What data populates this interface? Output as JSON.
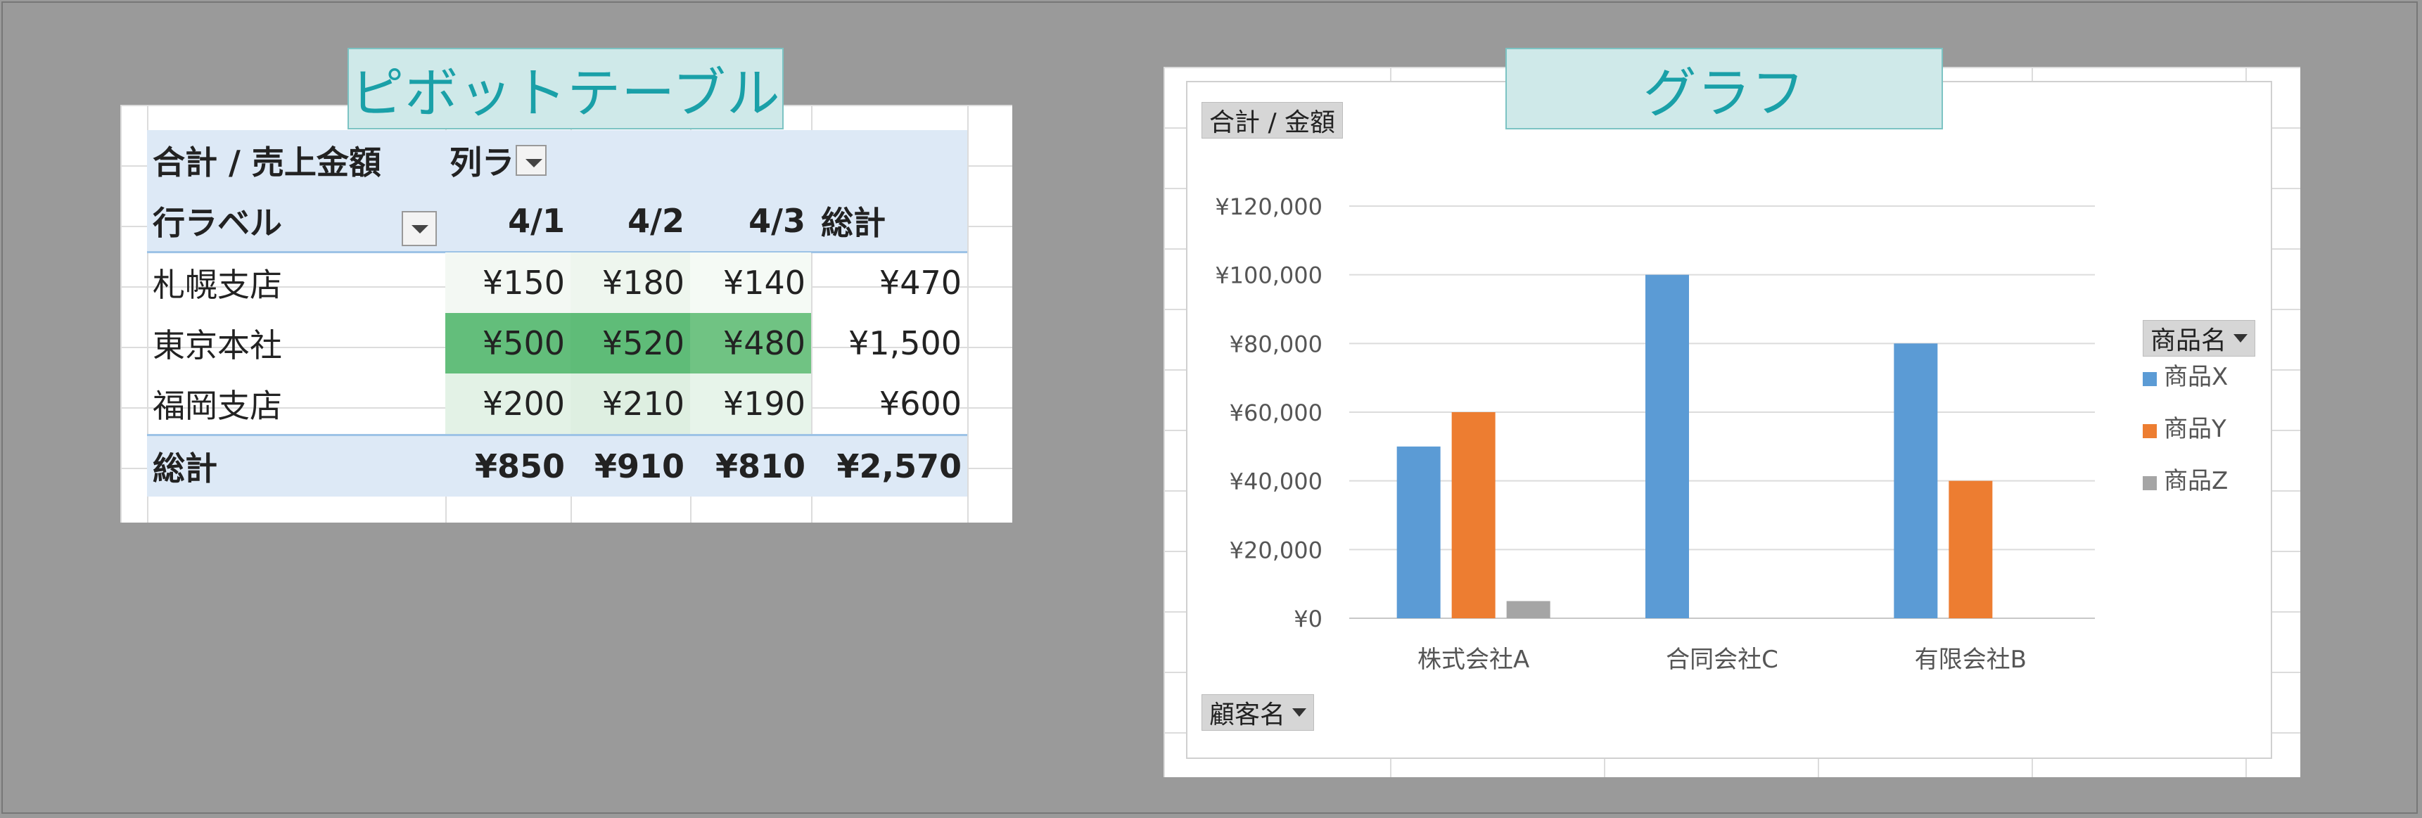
{
  "callouts": {
    "pivot": "ピボットテーブル",
    "chart": "グラフ"
  },
  "pivot": {
    "value_field": "合計 / 売上金額",
    "column_label": "列ラ",
    "row_label": "行ラベル",
    "columns": [
      "4/1",
      "4/2",
      "4/3",
      "総計"
    ],
    "rows": [
      {
        "label": "札幌支店",
        "values": [
          "¥150",
          "¥180",
          "¥140",
          "¥470"
        ]
      },
      {
        "label": "東京本社",
        "values": [
          "¥500",
          "¥520",
          "¥480",
          "¥1,500"
        ]
      },
      {
        "label": "福岡支店",
        "values": [
          "¥200",
          "¥210",
          "¥190",
          "¥600"
        ]
      }
    ],
    "total": {
      "label": "総計",
      "values": [
        "¥850",
        "¥910",
        "¥810",
        "¥2,570"
      ]
    },
    "heat_colors": {
      "row0": [
        "#f3f8f3",
        "#eef6ee",
        "#f5faf5"
      ],
      "row1": [
        "#63be7b",
        "#5fbc78",
        "#70c383"
      ],
      "row2": [
        "#e3f2e6",
        "#deefe1",
        "#e7f4ea"
      ]
    }
  },
  "chart": {
    "value_button": "合計 / 金額",
    "axis_button": "顧客名",
    "legend_button": "商品名",
    "legend": [
      {
        "name": "商品X",
        "color": "#5b9bd5"
      },
      {
        "name": "商品Y",
        "color": "#ed7d31"
      },
      {
        "name": "商品Z",
        "color": "#a5a5a5"
      }
    ]
  },
  "chart_data": {
    "type": "bar",
    "categories": [
      "株式会社A",
      "合同会社C",
      "有限会社B"
    ],
    "series": [
      {
        "name": "商品X",
        "values": [
          50000,
          100000,
          80000
        ]
      },
      {
        "name": "商品Y",
        "values": [
          60000,
          0,
          40000
        ]
      },
      {
        "name": "商品Z",
        "values": [
          5000,
          0,
          0
        ]
      }
    ],
    "yticks": [
      "¥0",
      "¥20,000",
      "¥40,000",
      "¥60,000",
      "¥80,000",
      "¥100,000",
      "¥120,000"
    ],
    "ylim": [
      0,
      120000
    ],
    "grid": true,
    "legend_position": "right"
  }
}
